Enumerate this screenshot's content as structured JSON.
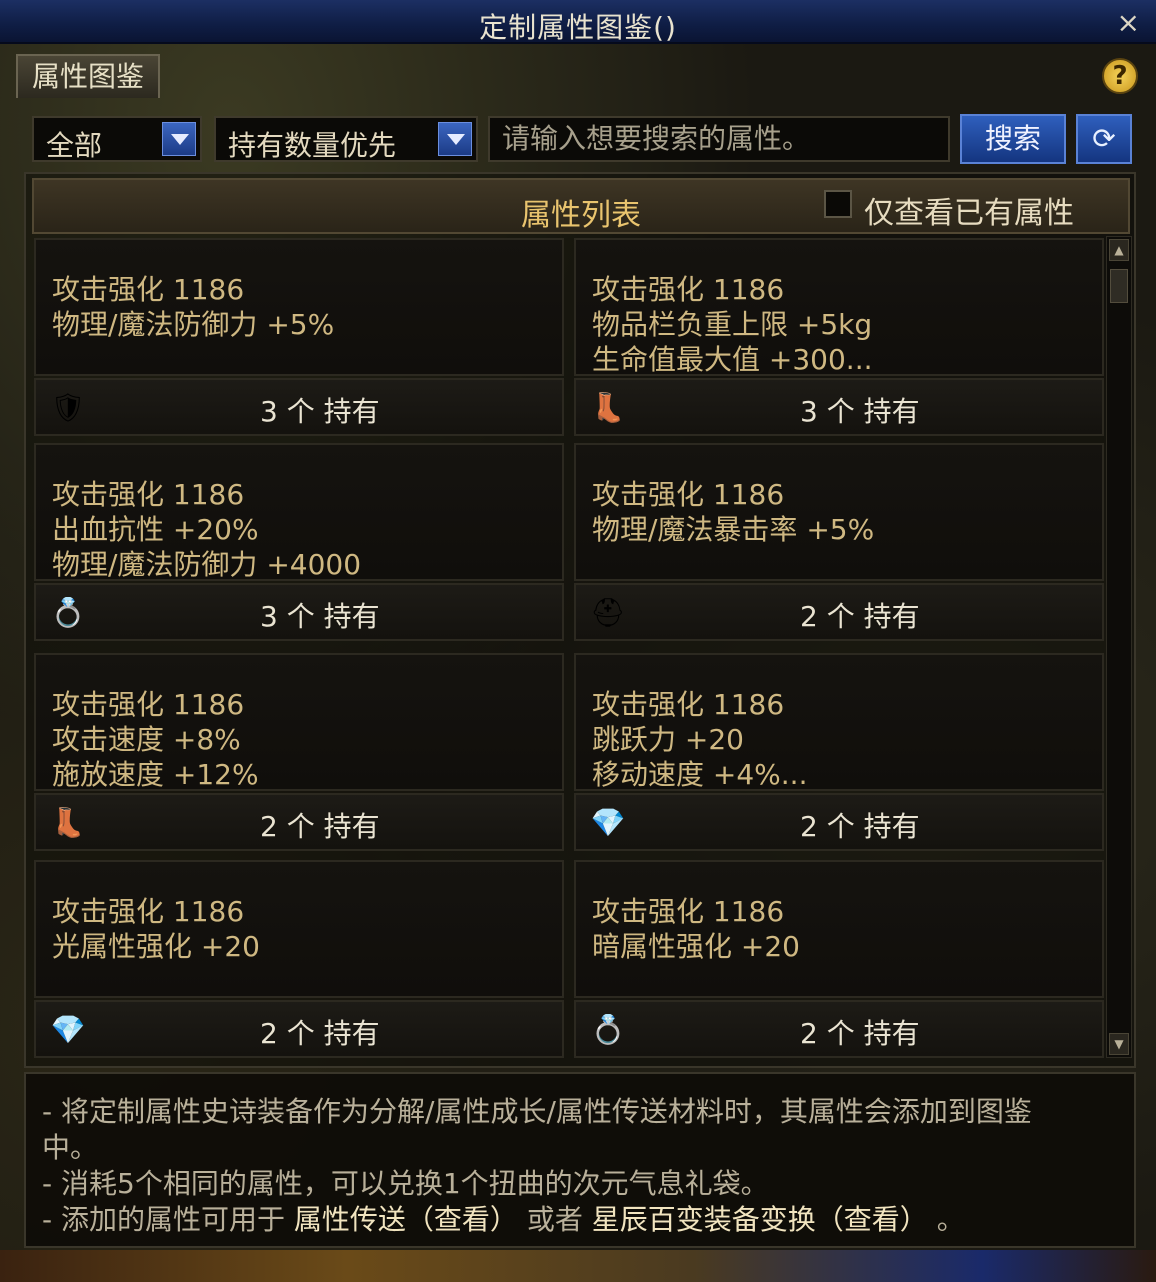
{
  "window": {
    "title": "定制属性图鉴()",
    "close_icon": "×"
  },
  "tab": {
    "label": "属性图鉴"
  },
  "help": {
    "label": "?"
  },
  "filters": {
    "category": "全部",
    "sort": "持有数量优先",
    "search_placeholder": "请输入想要搜索的属性。",
    "search_button": "搜索",
    "refresh_icon": "⟳"
  },
  "list": {
    "title": "属性列表",
    "only_owned_label": "仅查看已有属性",
    "items": [
      {
        "lines": [
          "攻击强化 1186",
          "物理/魔法防御力 +5%"
        ],
        "count": "3 个 持有",
        "icon": "armor-icon",
        "glyph": "🛡"
      },
      {
        "lines": [
          "攻击强化 1186",
          "物品栏负重上限 +5kg",
          "生命值最大值 +300..."
        ],
        "count": "3 个 持有",
        "icon": "boots-icon",
        "glyph": "👢"
      },
      {
        "lines": [
          "攻击强化 1186",
          "出血抗性 +20%",
          "物理/魔法防御力 +4000"
        ],
        "count": "3 个 持有",
        "icon": "ring-icon",
        "glyph": "💍"
      },
      {
        "lines": [
          "攻击强化 1186",
          "物理/魔法暴击率 +5%"
        ],
        "count": "2 个 持有",
        "icon": "helmet-icon",
        "glyph": "⛑"
      },
      {
        "lines": [
          "攻击强化 1186",
          "攻击速度 +8%",
          "施放速度 +12%"
        ],
        "count": "2 个 持有",
        "icon": "boots-icon",
        "glyph": "👢"
      },
      {
        "lines": [
          "攻击强化 1186",
          "跳跃力 +20",
          "移动速度 +4%..."
        ],
        "count": "2 个 持有",
        "icon": "gem-icon",
        "glyph": "💎"
      },
      {
        "lines": [
          "攻击强化 1186",
          "光属性强化 +20"
        ],
        "count": "2 个 持有",
        "icon": "gem-icon",
        "glyph": "💎"
      },
      {
        "lines": [
          "攻击强化 1186",
          "暗属性强化 +20"
        ],
        "count": "2 个 持有",
        "icon": "ring-icon",
        "glyph": "💍"
      }
    ]
  },
  "info": {
    "line1": "- 将定制属性史诗装备作为分解/属性成长/属性传送材料时，其属性会添加到图鉴",
    "line1b": "中。",
    "line2": "- 消耗5个相同的属性，可以兑换1个扭曲的次元气息礼袋。",
    "line3_pre": "- 添加的属性可用于",
    "line3_link1": "属性传送（查看）",
    "line3_mid": "或者",
    "line3_link2": "星辰百变装备变换（查看）",
    "line3_post": "。"
  }
}
